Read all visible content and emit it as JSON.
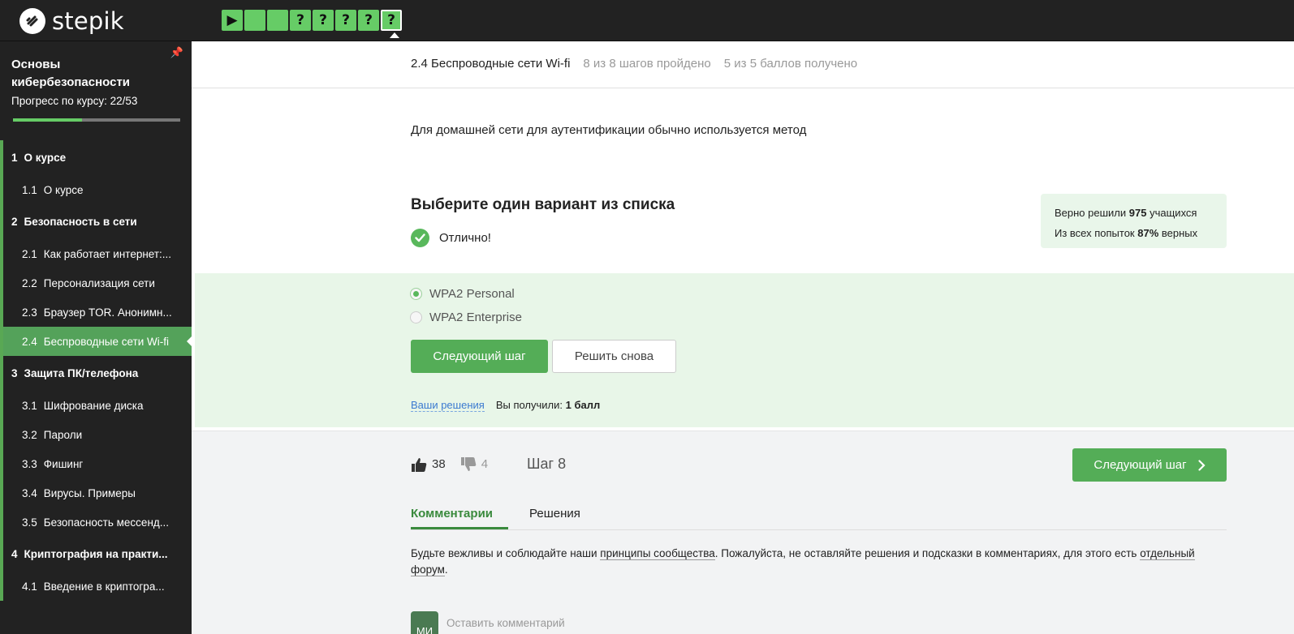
{
  "brand": {
    "name": "stepik"
  },
  "step_nav": {
    "steps": [
      {
        "type": "play",
        "glyph": "▶"
      },
      {
        "type": "done",
        "glyph": ""
      },
      {
        "type": "done",
        "glyph": ""
      },
      {
        "type": "quiz",
        "glyph": "?"
      },
      {
        "type": "quiz",
        "glyph": "?"
      },
      {
        "type": "quiz",
        "glyph": "?"
      },
      {
        "type": "quiz",
        "glyph": "?"
      },
      {
        "type": "quiz",
        "glyph": "?",
        "current": true
      }
    ]
  },
  "sidebar": {
    "course_title": "Основы кибербезопасности",
    "progress_label": "Прогресс по курсу:  22/53",
    "progress_fraction": 0.415,
    "items": [
      {
        "kind": "section",
        "num": "1",
        "label": "О курсе"
      },
      {
        "kind": "lesson",
        "num": "1.1",
        "label": "О курсе"
      },
      {
        "kind": "section",
        "num": "2",
        "label": "Безопасность в сети"
      },
      {
        "kind": "lesson",
        "num": "2.1",
        "label": "Как работает интернет:..."
      },
      {
        "kind": "lesson",
        "num": "2.2",
        "label": "Персонализация сети"
      },
      {
        "kind": "lesson",
        "num": "2.3",
        "label": "Браузер TOR. Анонимн..."
      },
      {
        "kind": "lesson",
        "num": "2.4",
        "label": "Беспроводные сети Wi-fi",
        "active": true
      },
      {
        "kind": "section",
        "num": "3",
        "label": "Защита ПК/телефона"
      },
      {
        "kind": "lesson",
        "num": "3.1",
        "label": "Шифрование диска"
      },
      {
        "kind": "lesson",
        "num": "3.2",
        "label": "Пароли"
      },
      {
        "kind": "lesson",
        "num": "3.3",
        "label": "Фишинг"
      },
      {
        "kind": "lesson",
        "num": "3.4",
        "label": "Вирусы. Примеры"
      },
      {
        "kind": "lesson",
        "num": "3.5",
        "label": "Безопасность мессенд..."
      },
      {
        "kind": "section",
        "num": "4",
        "label": "Криптография на практи..."
      },
      {
        "kind": "lesson",
        "num": "4.1",
        "label": "Введение в криптогра..."
      }
    ]
  },
  "lesson_header": {
    "title": "2.4 Беспроводные сети Wi-fi",
    "steps_passed": "8 из 8 шагов пройдено",
    "points": "5 из 5 баллов  получено"
  },
  "quiz": {
    "question": "Для домашней сети для аутентификации обычно используется метод",
    "instruction": "Выберите один вариант из списка",
    "result": "Отлично!",
    "options": [
      {
        "label": "WPA2 Personal",
        "checked": true
      },
      {
        "label": "WPA2 Enterprise",
        "checked": false
      }
    ],
    "next_button": "Следующий шаг",
    "retry_button": "Решить снова",
    "solutions_link": "Ваши решения",
    "score_prefix": "Вы получили:",
    "score_value": "1 балл"
  },
  "stats": {
    "solved_prefix": "Верно решили",
    "solved_count": "975",
    "solved_suffix": "учащихся",
    "attempts_prefix": "Из всех попыток",
    "attempts_percent": "87%",
    "attempts_suffix": "верных"
  },
  "footer": {
    "likes": "38",
    "dislikes": "4",
    "step_label": "Шаг 8",
    "next_button": "Следующий шаг",
    "tabs": [
      "Комментарии",
      "Решения"
    ],
    "rules_part1": "Будьте вежливы и соблюдайте наши ",
    "rules_link1": "принципы сообщества",
    "rules_part2": ". Пожалуйста, не оставляйте решения и подсказки в комментариях, для этого есть ",
    "rules_link2": "отдельный форум",
    "rules_part3": ".",
    "avatar_initials": "МИ",
    "comment_placeholder": "Оставить комментарий"
  },
  "colors": {
    "accent_green": "#54ad57",
    "answer_bg": "#e8f6e8",
    "dark_bg": "#222222",
    "link_blue": "#3b7ad0"
  }
}
